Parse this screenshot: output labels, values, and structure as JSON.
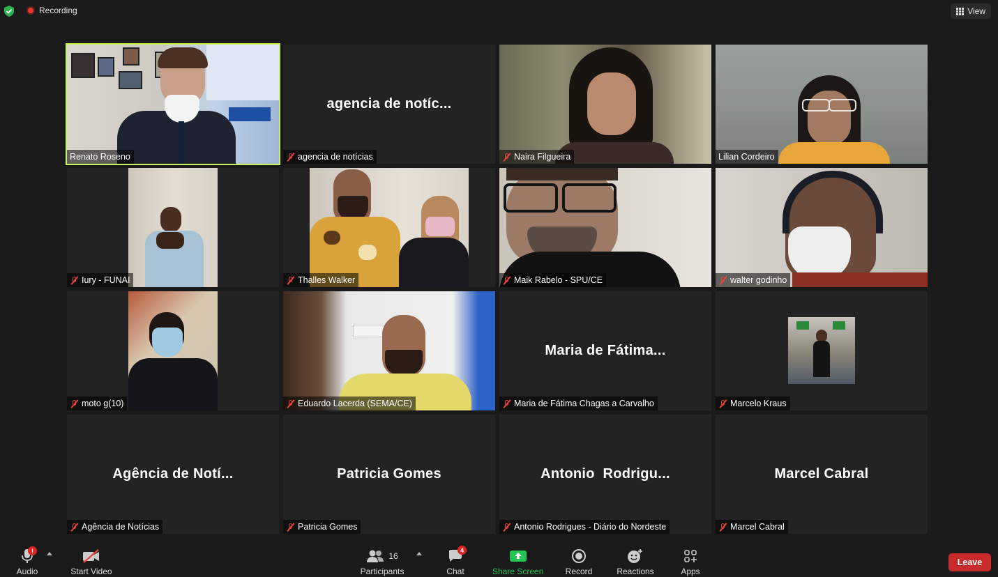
{
  "top": {
    "recording_label": "Recording",
    "view_label": "View"
  },
  "tiles": [
    {
      "name": "Renato Roseno"
    },
    {
      "name": "agencia de notícias",
      "display_name": "agencia de notíc..."
    },
    {
      "name": "Naira Filgueira"
    },
    {
      "name": "Lilian Cordeiro"
    },
    {
      "name": "Iury - FUNAI"
    },
    {
      "name": "Thalles Walker"
    },
    {
      "name": "Maik Rabelo - SPU/CE"
    },
    {
      "name": "walter godinho"
    },
    {
      "name": "moto g(10)"
    },
    {
      "name": "Eduardo Lacerda (SEMA/CE)"
    },
    {
      "name": "Maria de Fátima Chagas a Carvalho",
      "display_name": "Maria de Fátima..."
    },
    {
      "name": "Marcelo Kraus"
    },
    {
      "name": "Agência de Notícias",
      "display_name": "Agência de Notí..."
    },
    {
      "name": "Patricia Gomes",
      "display_name": "Patricia Gomes"
    },
    {
      "name": "Antonio Rodrigues - Diário do Nordeste",
      "display_name": "Antonio  Rodrigu..."
    },
    {
      "name": "Marcel Cabral",
      "display_name": "Marcel Cabral"
    }
  ],
  "toolbar": {
    "audio_label": "Audio",
    "audio_badge": "!",
    "video_label": "Start Video",
    "participants_label": "Participants",
    "participants_count": "16",
    "chat_label": "Chat",
    "chat_badge": "4",
    "share_label": "Share Screen",
    "record_label": "Record",
    "reactions_label": "Reactions",
    "apps_label": "Apps",
    "leave_label": "Leave"
  },
  "colors": {
    "active_speaker_border": "#c9f25a",
    "share_green": "#23c552",
    "leave_red": "#c92a2a",
    "mute_red": "#e8453c"
  }
}
